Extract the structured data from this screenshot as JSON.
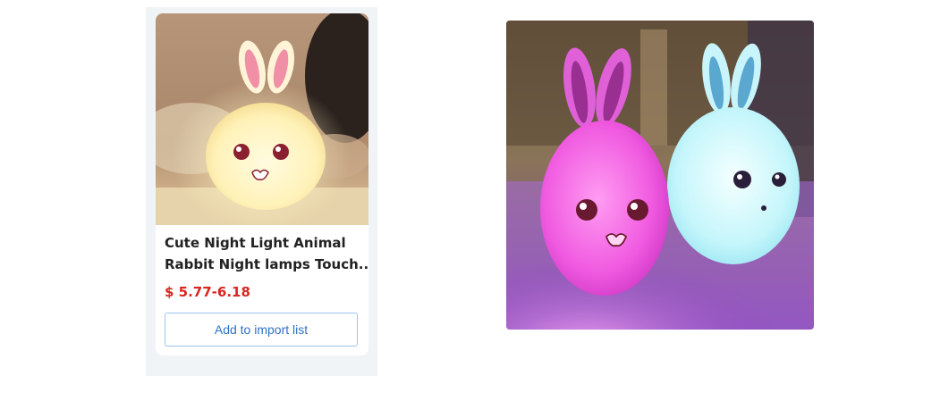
{
  "product_card": {
    "image": "yellow-rabbit-night-light-image",
    "title_line1": "Cute Night Light Animal",
    "title_line2": "Rabbit Night lamps Touch...",
    "price": "$ 5.77-6.18",
    "import_button_label": "Add to import list",
    "colors": {
      "price": "#d7261e",
      "button_text": "#2f72c4",
      "button_border": "#9ec3ea",
      "panel_bg": "#f1f4f7"
    }
  },
  "preview": {
    "image": "pink-and-blue-rabbit-lamps-image"
  }
}
